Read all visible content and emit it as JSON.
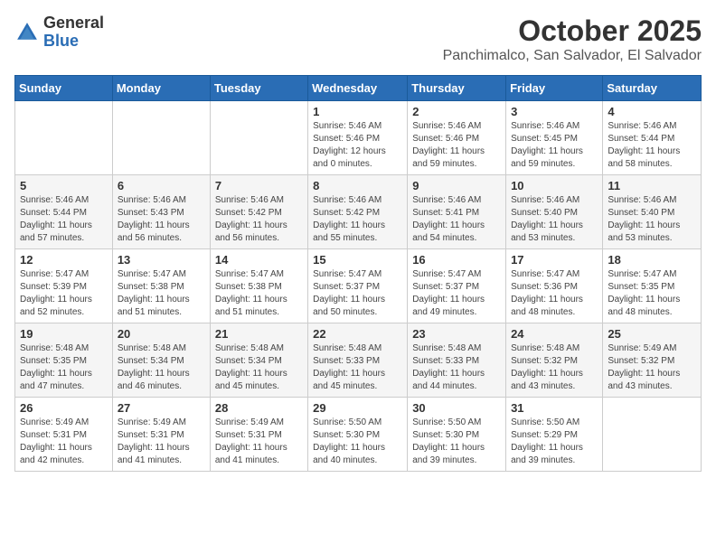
{
  "logo": {
    "general": "General",
    "blue": "Blue"
  },
  "header": {
    "month": "October 2025",
    "location": "Panchimalco, San Salvador, El Salvador"
  },
  "weekdays": [
    "Sunday",
    "Monday",
    "Tuesday",
    "Wednesday",
    "Thursday",
    "Friday",
    "Saturday"
  ],
  "weeks": [
    [
      {
        "day": "",
        "sunrise": "",
        "sunset": "",
        "daylight": ""
      },
      {
        "day": "",
        "sunrise": "",
        "sunset": "",
        "daylight": ""
      },
      {
        "day": "",
        "sunrise": "",
        "sunset": "",
        "daylight": ""
      },
      {
        "day": "1",
        "sunrise": "Sunrise: 5:46 AM",
        "sunset": "Sunset: 5:46 PM",
        "daylight": "Daylight: 12 hours and 0 minutes."
      },
      {
        "day": "2",
        "sunrise": "Sunrise: 5:46 AM",
        "sunset": "Sunset: 5:46 PM",
        "daylight": "Daylight: 11 hours and 59 minutes."
      },
      {
        "day": "3",
        "sunrise": "Sunrise: 5:46 AM",
        "sunset": "Sunset: 5:45 PM",
        "daylight": "Daylight: 11 hours and 59 minutes."
      },
      {
        "day": "4",
        "sunrise": "Sunrise: 5:46 AM",
        "sunset": "Sunset: 5:44 PM",
        "daylight": "Daylight: 11 hours and 58 minutes."
      }
    ],
    [
      {
        "day": "5",
        "sunrise": "Sunrise: 5:46 AM",
        "sunset": "Sunset: 5:44 PM",
        "daylight": "Daylight: 11 hours and 57 minutes."
      },
      {
        "day": "6",
        "sunrise": "Sunrise: 5:46 AM",
        "sunset": "Sunset: 5:43 PM",
        "daylight": "Daylight: 11 hours and 56 minutes."
      },
      {
        "day": "7",
        "sunrise": "Sunrise: 5:46 AM",
        "sunset": "Sunset: 5:42 PM",
        "daylight": "Daylight: 11 hours and 56 minutes."
      },
      {
        "day": "8",
        "sunrise": "Sunrise: 5:46 AM",
        "sunset": "Sunset: 5:42 PM",
        "daylight": "Daylight: 11 hours and 55 minutes."
      },
      {
        "day": "9",
        "sunrise": "Sunrise: 5:46 AM",
        "sunset": "Sunset: 5:41 PM",
        "daylight": "Daylight: 11 hours and 54 minutes."
      },
      {
        "day": "10",
        "sunrise": "Sunrise: 5:46 AM",
        "sunset": "Sunset: 5:40 PM",
        "daylight": "Daylight: 11 hours and 53 minutes."
      },
      {
        "day": "11",
        "sunrise": "Sunrise: 5:46 AM",
        "sunset": "Sunset: 5:40 PM",
        "daylight": "Daylight: 11 hours and 53 minutes."
      }
    ],
    [
      {
        "day": "12",
        "sunrise": "Sunrise: 5:47 AM",
        "sunset": "Sunset: 5:39 PM",
        "daylight": "Daylight: 11 hours and 52 minutes."
      },
      {
        "day": "13",
        "sunrise": "Sunrise: 5:47 AM",
        "sunset": "Sunset: 5:38 PM",
        "daylight": "Daylight: 11 hours and 51 minutes."
      },
      {
        "day": "14",
        "sunrise": "Sunrise: 5:47 AM",
        "sunset": "Sunset: 5:38 PM",
        "daylight": "Daylight: 11 hours and 51 minutes."
      },
      {
        "day": "15",
        "sunrise": "Sunrise: 5:47 AM",
        "sunset": "Sunset: 5:37 PM",
        "daylight": "Daylight: 11 hours and 50 minutes."
      },
      {
        "day": "16",
        "sunrise": "Sunrise: 5:47 AM",
        "sunset": "Sunset: 5:37 PM",
        "daylight": "Daylight: 11 hours and 49 minutes."
      },
      {
        "day": "17",
        "sunrise": "Sunrise: 5:47 AM",
        "sunset": "Sunset: 5:36 PM",
        "daylight": "Daylight: 11 hours and 48 minutes."
      },
      {
        "day": "18",
        "sunrise": "Sunrise: 5:47 AM",
        "sunset": "Sunset: 5:35 PM",
        "daylight": "Daylight: 11 hours and 48 minutes."
      }
    ],
    [
      {
        "day": "19",
        "sunrise": "Sunrise: 5:48 AM",
        "sunset": "Sunset: 5:35 PM",
        "daylight": "Daylight: 11 hours and 47 minutes."
      },
      {
        "day": "20",
        "sunrise": "Sunrise: 5:48 AM",
        "sunset": "Sunset: 5:34 PM",
        "daylight": "Daylight: 11 hours and 46 minutes."
      },
      {
        "day": "21",
        "sunrise": "Sunrise: 5:48 AM",
        "sunset": "Sunset: 5:34 PM",
        "daylight": "Daylight: 11 hours and 45 minutes."
      },
      {
        "day": "22",
        "sunrise": "Sunrise: 5:48 AM",
        "sunset": "Sunset: 5:33 PM",
        "daylight": "Daylight: 11 hours and 45 minutes."
      },
      {
        "day": "23",
        "sunrise": "Sunrise: 5:48 AM",
        "sunset": "Sunset: 5:33 PM",
        "daylight": "Daylight: 11 hours and 44 minutes."
      },
      {
        "day": "24",
        "sunrise": "Sunrise: 5:48 AM",
        "sunset": "Sunset: 5:32 PM",
        "daylight": "Daylight: 11 hours and 43 minutes."
      },
      {
        "day": "25",
        "sunrise": "Sunrise: 5:49 AM",
        "sunset": "Sunset: 5:32 PM",
        "daylight": "Daylight: 11 hours and 43 minutes."
      }
    ],
    [
      {
        "day": "26",
        "sunrise": "Sunrise: 5:49 AM",
        "sunset": "Sunset: 5:31 PM",
        "daylight": "Daylight: 11 hours and 42 minutes."
      },
      {
        "day": "27",
        "sunrise": "Sunrise: 5:49 AM",
        "sunset": "Sunset: 5:31 PM",
        "daylight": "Daylight: 11 hours and 41 minutes."
      },
      {
        "day": "28",
        "sunrise": "Sunrise: 5:49 AM",
        "sunset": "Sunset: 5:31 PM",
        "daylight": "Daylight: 11 hours and 41 minutes."
      },
      {
        "day": "29",
        "sunrise": "Sunrise: 5:50 AM",
        "sunset": "Sunset: 5:30 PM",
        "daylight": "Daylight: 11 hours and 40 minutes."
      },
      {
        "day": "30",
        "sunrise": "Sunrise: 5:50 AM",
        "sunset": "Sunset: 5:30 PM",
        "daylight": "Daylight: 11 hours and 39 minutes."
      },
      {
        "day": "31",
        "sunrise": "Sunrise: 5:50 AM",
        "sunset": "Sunset: 5:29 PM",
        "daylight": "Daylight: 11 hours and 39 minutes."
      },
      {
        "day": "",
        "sunrise": "",
        "sunset": "",
        "daylight": ""
      }
    ]
  ]
}
